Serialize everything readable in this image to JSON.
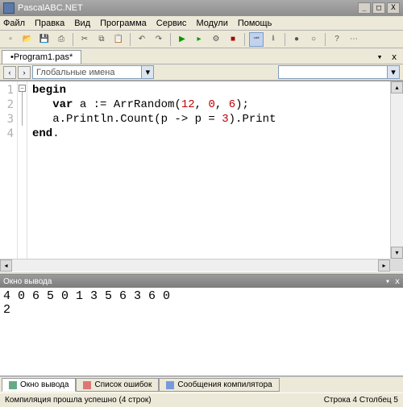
{
  "window": {
    "title": "PascalABC.NET"
  },
  "menu": {
    "file": "Файл",
    "edit": "Правка",
    "view": "Вид",
    "program": "Программа",
    "service": "Сервис",
    "modules": "Модули",
    "help": "Помощь"
  },
  "tab": {
    "filename": "•Program1.pas*"
  },
  "search": {
    "placeholder": "Глобальные имена"
  },
  "code": {
    "lines": [
      "1",
      "2",
      "3",
      "4"
    ],
    "l1_kw": "begin",
    "l2_kw": "var",
    "l2_a": " a := ArrRandom(",
    "l2_n1": "12",
    "l2_c1": ", ",
    "l2_n2": "0",
    "l2_c2": ", ",
    "l2_n3": "6",
    "l2_end": ");",
    "l3": "   a.Println.Count(p -> p = ",
    "l3_n": "3",
    "l3_end": ").Print",
    "l4_kw": "end",
    "l4_dot": "."
  },
  "outputPanel": {
    "title": "Окно вывода"
  },
  "output": {
    "line1": "4 0 6 5 0 1 3 5 6 3 6 0",
    "line2": "2"
  },
  "bottomTabs": {
    "t1": "Окно вывода",
    "t2": "Список ошибок",
    "t3": "Сообщения компилятора"
  },
  "status": {
    "msg": "Компиляция прошла успешно (4 строк)",
    "pos": "Строка  4  Столбец  5"
  }
}
